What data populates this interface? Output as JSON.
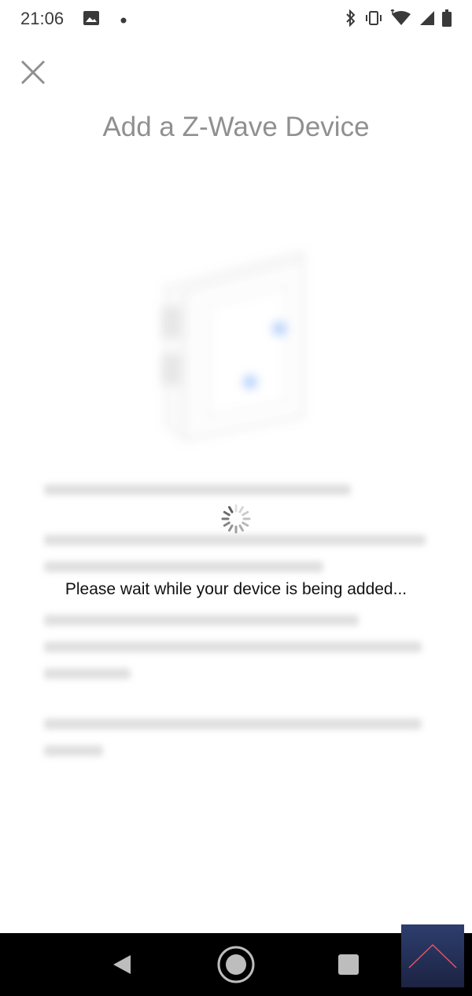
{
  "status_bar": {
    "time": "21:06",
    "icons": [
      "image-icon",
      "dot-icon",
      "bluetooth-icon",
      "vibrate-icon",
      "wifi-icon",
      "signal-icon",
      "battery-icon"
    ]
  },
  "header": {
    "close_icon": "close-icon",
    "title": "Add a Z-Wave Device"
  },
  "loading": {
    "message": "Please wait while your device is being added..."
  },
  "nav_bar": {
    "icons": [
      "back-icon",
      "home-icon",
      "recents-icon",
      "scroll-up-icon"
    ]
  },
  "colors": {
    "accent_led": "#3b82f6",
    "title": "#555555",
    "nav_background": "#000000"
  }
}
